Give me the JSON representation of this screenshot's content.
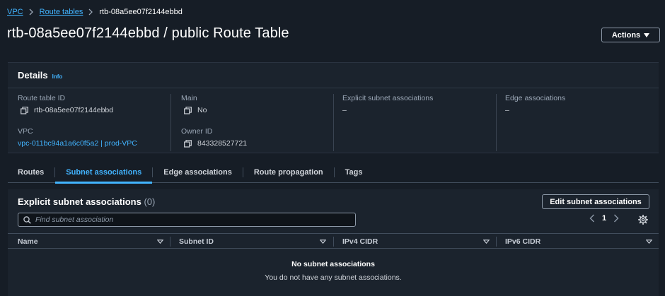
{
  "breadcrumb": {
    "items": [
      "VPC",
      "Route tables"
    ],
    "current": "rtb-08a5ee07f2144ebbd"
  },
  "header": {
    "title": "rtb-08a5ee07f2144ebbd / public Route Table",
    "actions_label": "Actions"
  },
  "details": {
    "title": "Details",
    "info_label": "Info",
    "fields": {
      "route_table_id": {
        "label": "Route table ID",
        "value": "rtb-08a5ee07f2144ebbd"
      },
      "vpc": {
        "label": "VPC",
        "value": "vpc-011bc94a1a6c0f5a2 | prod-VPC"
      },
      "main": {
        "label": "Main",
        "value": "No"
      },
      "owner_id": {
        "label": "Owner ID",
        "value": "843328527721"
      },
      "explicit_subnet": {
        "label": "Explicit subnet associations",
        "value": "–"
      },
      "edge": {
        "label": "Edge associations",
        "value": "–"
      }
    }
  },
  "tabs": [
    {
      "label": "Routes",
      "active": false
    },
    {
      "label": "Subnet associations",
      "active": true
    },
    {
      "label": "Edge associations",
      "active": false
    },
    {
      "label": "Route propagation",
      "active": false
    },
    {
      "label": "Tags",
      "active": false
    }
  ],
  "associations": {
    "title": "Explicit subnet associations",
    "count": "(0)",
    "edit_label": "Edit subnet associations",
    "search_placeholder": "Find subnet association",
    "page": "1",
    "columns": [
      "Name",
      "Subnet ID",
      "IPv4 CIDR",
      "IPv6 CIDR"
    ],
    "empty_title": "No subnet associations",
    "empty_message": "You do not have any subnet associations."
  },
  "colors": {
    "background": "#161d26",
    "panel": "#1b232d",
    "link": "#42b4ff"
  },
  "icons": [
    "chevron-right-icon",
    "caret-down-icon",
    "copy-icon",
    "search-icon",
    "chevron-left-icon",
    "gear-icon",
    "sort-caret-icon"
  ]
}
